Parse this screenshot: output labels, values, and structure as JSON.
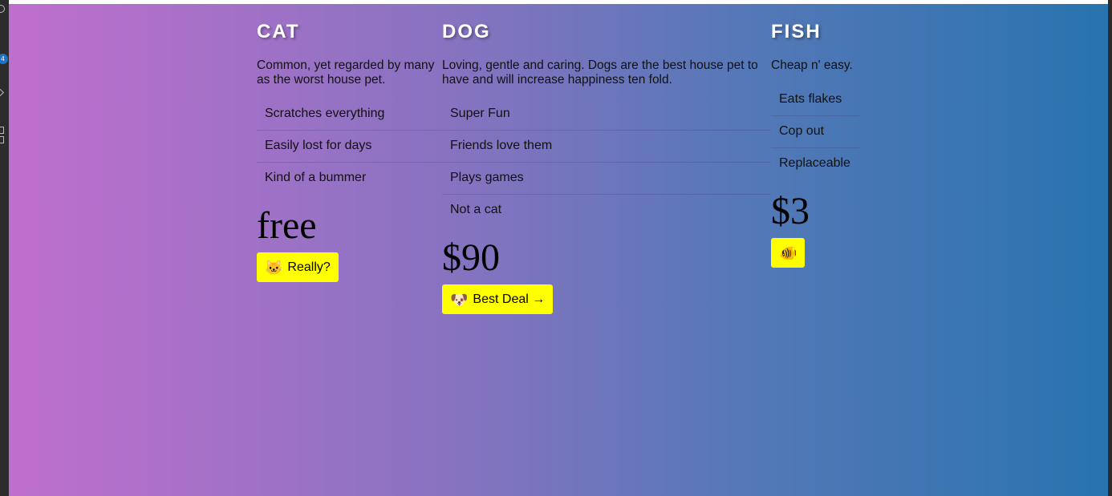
{
  "pets": [
    {
      "title": "CAT",
      "description": "Common, yet regarded by many as the worst house pet.",
      "features": [
        "Scratches everything",
        "Easily lost for days",
        "Kind of a bummer"
      ],
      "price": "free",
      "button": {
        "icon": "🐱",
        "icon_name": "cat-face-icon",
        "label": "Really?"
      }
    },
    {
      "title": "DOG",
      "description": "Loving, gentle and caring. Dogs are the best house pet to have and will increase happiness ten fold.",
      "features": [
        "Super Fun",
        "Friends love them",
        "Plays games",
        "Not a cat"
      ],
      "price": "$90",
      "button": {
        "icon": "🐶",
        "icon_name": "dog-face-icon",
        "label": "Best Deal →"
      }
    },
    {
      "title": "FISH",
      "description": "Cheap n' easy.",
      "features": [
        "Eats flakes",
        "Cop out",
        "Replaceable"
      ],
      "price": "$3",
      "button": {
        "icon": "🐠",
        "icon_name": "tropical-fish-icon",
        "label": ""
      }
    }
  ],
  "colors": {
    "gradient_start": "#bf6fce",
    "gradient_end": "#2874ae",
    "button_bg": "#ffff00"
  },
  "editor_badge": "4"
}
